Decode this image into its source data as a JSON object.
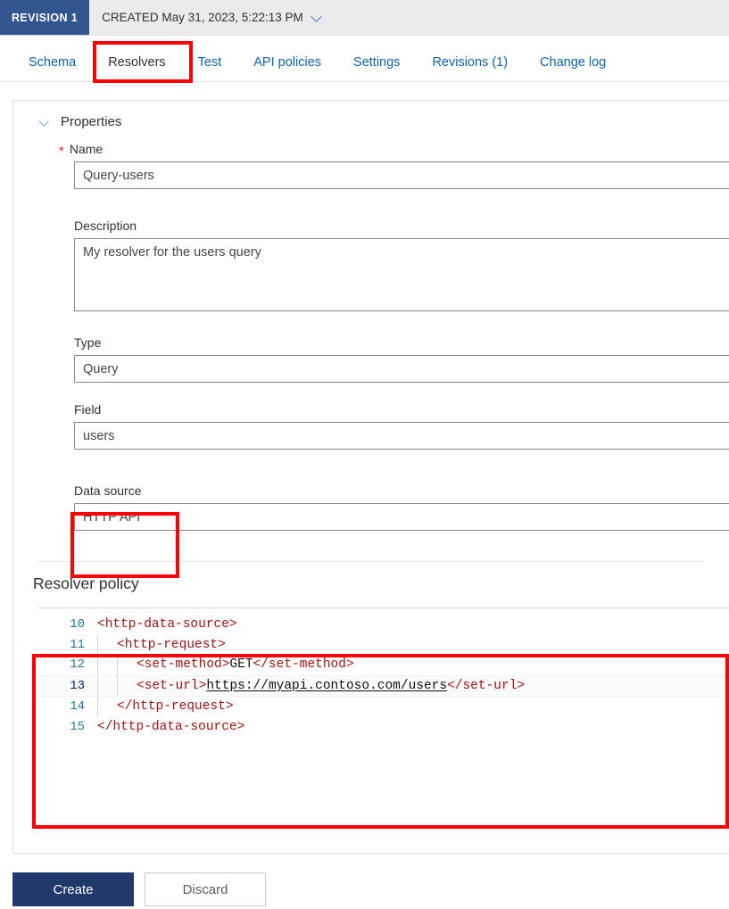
{
  "header": {
    "revision_badge": "REVISION 1",
    "created_text": "CREATED May 31, 2023, 5:22:13 PM",
    "chevron_icon": "chevron-down-icon"
  },
  "tabs": [
    {
      "label": "Schema",
      "active": false
    },
    {
      "label": "Resolvers",
      "active": true
    },
    {
      "label": "Test",
      "active": false
    },
    {
      "label": "API policies",
      "active": false
    },
    {
      "label": "Settings",
      "active": false
    },
    {
      "label": "Revisions (1)",
      "active": false
    },
    {
      "label": "Change log",
      "active": false
    }
  ],
  "properties": {
    "section_title": "Properties",
    "collapse_icon": "chevron-down-icon",
    "name": {
      "label": "Name",
      "required_marker": "*",
      "value": "Query-users"
    },
    "description": {
      "label": "Description",
      "value": "My resolver for the users query"
    },
    "type": {
      "label": "Type",
      "value": "Query"
    },
    "field": {
      "label": "Field",
      "value": "users"
    },
    "data_source": {
      "label": "Data source",
      "value": "HTTP API"
    }
  },
  "resolver_policy": {
    "title": "Resolver policy",
    "active_line": 13,
    "lines": [
      {
        "number": "10",
        "indent": 0,
        "tokens": [
          {
            "text": "<http-data-source>",
            "kind": "tag"
          }
        ]
      },
      {
        "number": "11",
        "indent": 1,
        "tokens": [
          {
            "text": "    <http-request>",
            "kind": "tag"
          }
        ]
      },
      {
        "number": "12",
        "indent": 2,
        "tokens": [
          {
            "text": "        <set-method>",
            "kind": "tag"
          },
          {
            "text": "GET",
            "kind": "plain"
          },
          {
            "text": "</set-method>",
            "kind": "tag"
          }
        ]
      },
      {
        "number": "13",
        "indent": 2,
        "tokens": [
          {
            "text": "        <set-url>",
            "kind": "tag"
          },
          {
            "text": "https://myapi.contoso.com/users",
            "kind": "url"
          },
          {
            "text": "</set-url>",
            "kind": "tag"
          }
        ]
      },
      {
        "number": "14",
        "indent": 1,
        "tokens": [
          {
            "text": "    </http-request>",
            "kind": "tag"
          }
        ]
      },
      {
        "number": "15",
        "indent": 0,
        "tokens": [
          {
            "text": "</http-data-source>",
            "kind": "tag"
          }
        ]
      }
    ]
  },
  "footer": {
    "create_label": "Create",
    "discard_label": "Discard"
  },
  "annotations": [
    {
      "name": "resolvers-tab-highlight",
      "color": "#ff0000"
    },
    {
      "name": "data-source-highlight",
      "color": "#ff0000"
    },
    {
      "name": "resolver-policy-highlight",
      "color": "#ff0000"
    }
  ]
}
